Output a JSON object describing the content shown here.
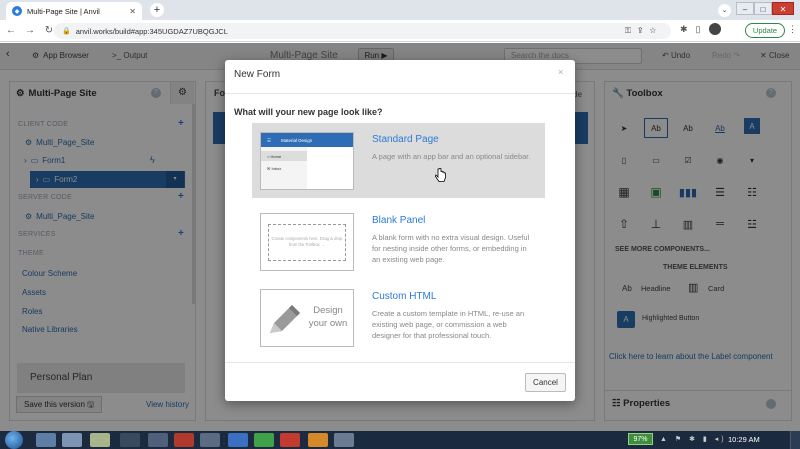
{
  "browser": {
    "tab_title": "Multi-Page Site | Anvil",
    "url": "anvil.works/build#app:345UGDAZ7UBQGJCL",
    "update_label": "Update"
  },
  "toolbar": {
    "app_browser_label": "App Browser",
    "output_label": "Output",
    "app_title": "Multi-Page Site",
    "run_label": "Run",
    "search_placeholder": "Search the docs",
    "undo_label": "Undo",
    "redo_label": "Redo",
    "close_label": "Close"
  },
  "left_panel": {
    "title": "Multi-Page Site",
    "client_code_label": "CLIENT CODE",
    "client_module": "Multi_Page_Site",
    "forms": [
      "Form1",
      "Form2"
    ],
    "server_code_label": "SERVER CODE",
    "server_module": "Multi_Page_Site",
    "services_label": "SERVICES",
    "theme_label": "THEME",
    "theme_items": [
      "Colour Scheme",
      "Assets",
      "Roles",
      "Native Libraries"
    ],
    "plan_label": "Personal Plan",
    "save_version_label": "Save this version",
    "view_history_label": "View history"
  },
  "middle": {
    "heading_fragment": "Fo",
    "right_fragment": "de"
  },
  "right_panel": {
    "title": "Toolbox",
    "tools": [
      "pointer",
      "Ab",
      "Ab",
      "Ab",
      "A",
      "textarea",
      "input",
      "checkbox",
      "radio",
      "dropdown",
      "calendar",
      "image",
      "plot",
      "repeating-panel",
      "grid",
      "file-loader",
      "spacer",
      "column-panel",
      "flow-panel",
      "data-grid"
    ],
    "see_more_label": "SEE MORE COMPONENTS...",
    "theme_elements_label": "THEME ELEMENTS",
    "headline_ab": "Ab",
    "headline_label": "Headline",
    "card_label": "Card",
    "highlight_icon": "A",
    "highlight_label": "Highlighted Button",
    "learn_link": "Click here to learn about the Label component",
    "properties_label": "Properties"
  },
  "modal": {
    "title": "New Form",
    "close": "×",
    "question": "What will your new page look like?",
    "options": [
      {
        "title": "Standard Page",
        "description": "A page with an app bar and an optional sidebar.",
        "thumb_bar": "Material Design",
        "thumb_nav": [
          "Home",
          "Inbox"
        ]
      },
      {
        "title": "Blank Panel",
        "description": "A blank form with no extra visual design. Useful for nesting inside other forms, or embedding in an existing web page.",
        "thumb_text": "Create components here. Drag & drop from the Toolbox →"
      },
      {
        "title": "Custom HTML",
        "description": "Create a custom template in HTML, re-use an existing web page, or commission a web designer for that professional touch.",
        "thumb_text_1": "Design",
        "thumb_text_2": "your own"
      }
    ],
    "cancel_label": "Cancel"
  },
  "taskbar": {
    "battery": "97%",
    "clock": "10:29 AM"
  },
  "colors": {
    "accent": "#2b7bd8",
    "selected_row": "#2e6db5",
    "update_green": "#2a8a45"
  }
}
